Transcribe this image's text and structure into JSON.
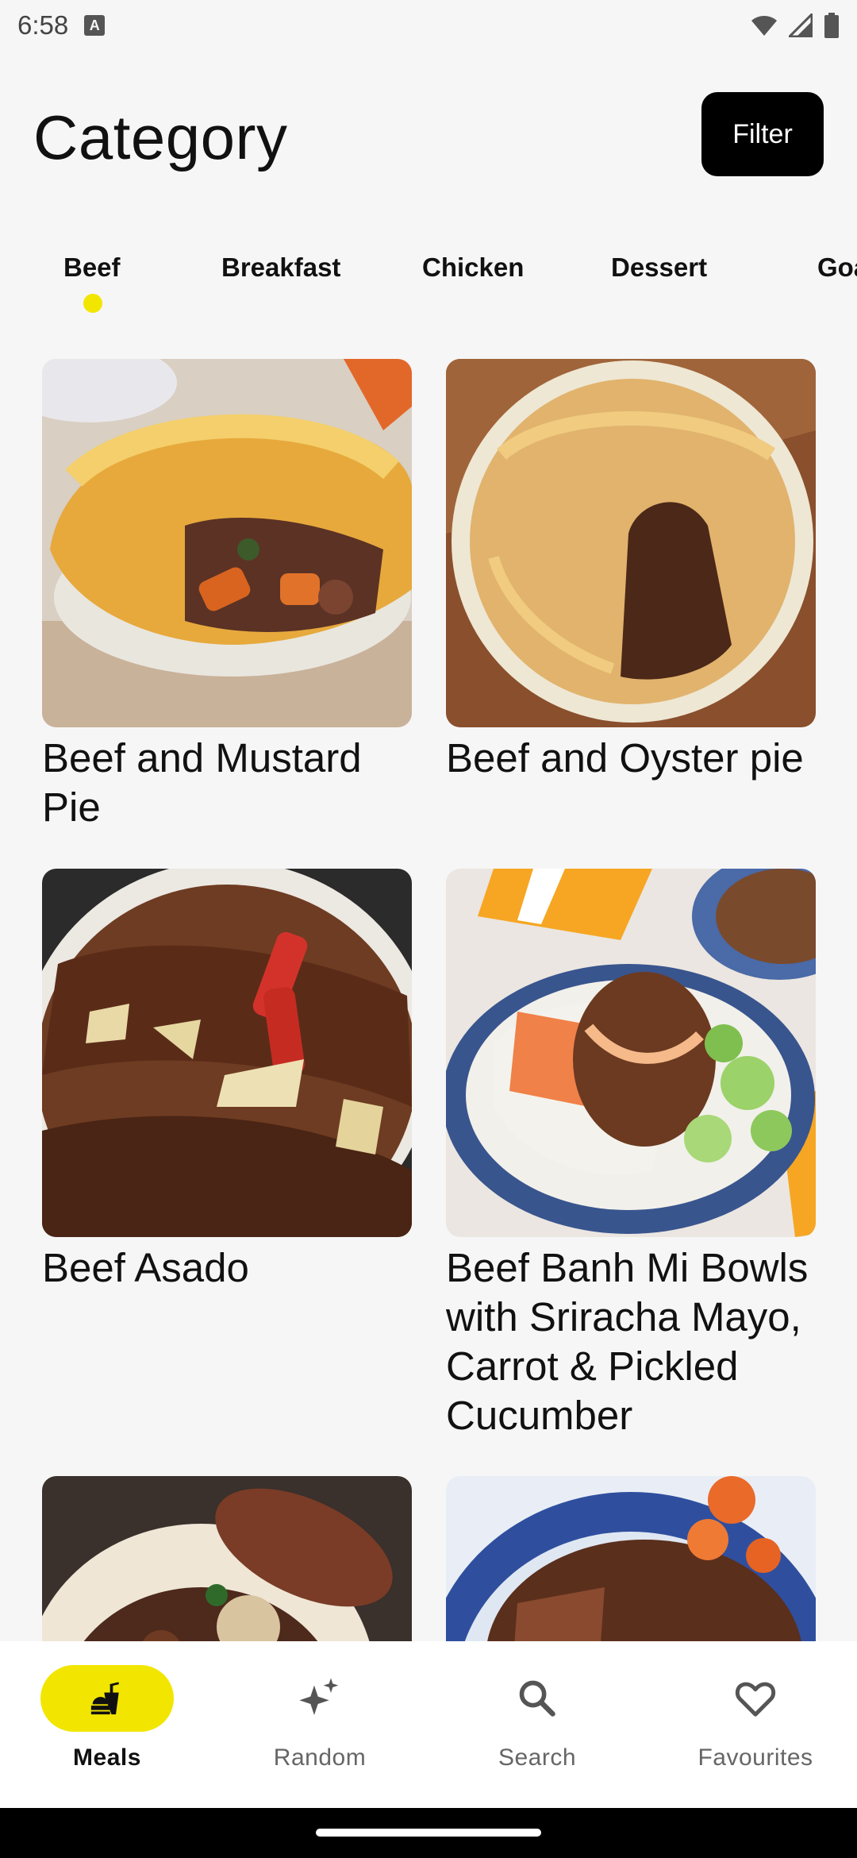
{
  "status_bar": {
    "time": "6:58",
    "icons": [
      "notification-a-icon",
      "wifi-icon",
      "signal-icon",
      "battery-icon"
    ]
  },
  "header": {
    "title": "Category",
    "filter_label": "Filter"
  },
  "tabs": [
    {
      "label": "Beef",
      "selected": true
    },
    {
      "label": "Breakfast",
      "selected": false
    },
    {
      "label": "Chicken",
      "selected": false
    },
    {
      "label": "Dessert",
      "selected": false
    },
    {
      "label": "Goat",
      "selected": false
    }
  ],
  "meals": [
    {
      "name": "Beef and Mustard Pie"
    },
    {
      "name": "Beef and Oyster pie"
    },
    {
      "name": "Beef Asado"
    },
    {
      "name": "Beef Banh Mi Bowls with Sriracha Mayo, Carrot & Pickled Cucumber"
    },
    {
      "name": ""
    },
    {
      "name": ""
    }
  ],
  "bottom_nav": [
    {
      "label": "Meals",
      "icon": "fastfood-icon",
      "active": true
    },
    {
      "label": "Random",
      "icon": "sparkle-icon",
      "active": false
    },
    {
      "label": "Search",
      "icon": "search-icon",
      "active": false
    },
    {
      "label": "Favourites",
      "icon": "heart-icon",
      "active": false
    }
  ],
  "colors": {
    "accent": "#f2e600",
    "background": "#f6f6f6",
    "filter_button": "#000000"
  }
}
